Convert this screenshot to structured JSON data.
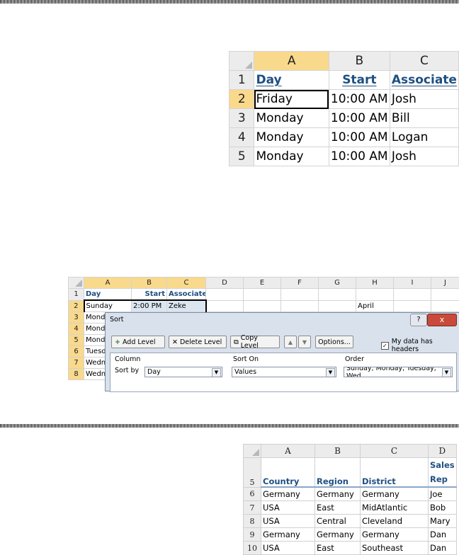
{
  "sheet1": {
    "col_headers": [
      "A",
      "B",
      "C"
    ],
    "header_row": {
      "num": "1",
      "cells": [
        "Day",
        "Start",
        "Associate"
      ]
    },
    "rows": [
      {
        "num": "2",
        "cells": [
          "Friday",
          "10:00 AM",
          "Josh"
        ]
      },
      {
        "num": "3",
        "cells": [
          "Monday",
          "10:00 AM",
          "Bill"
        ]
      },
      {
        "num": "4",
        "cells": [
          "Monday",
          "10:00 AM",
          "Logan"
        ]
      },
      {
        "num": "5",
        "cells": [
          "Monday",
          "10:00 AM",
          "Josh"
        ]
      }
    ]
  },
  "sheet2": {
    "col_headers": [
      "A",
      "B",
      "C",
      "D",
      "E",
      "F",
      "G",
      "H",
      "I",
      "J"
    ],
    "header_row": {
      "num": "1",
      "cells": [
        "Day",
        "Start",
        "Associate"
      ]
    },
    "row2": {
      "num": "2",
      "cells": [
        "Sunday",
        "2:00 PM",
        "Zeke"
      ],
      "h": "April"
    },
    "partial_rows": [
      {
        "num": "3",
        "a": "Mond"
      },
      {
        "num": "4",
        "a": "Mond"
      },
      {
        "num": "5",
        "a": "Mond"
      },
      {
        "num": "6",
        "a": "Tuesd"
      },
      {
        "num": "7",
        "a": "Wedn"
      },
      {
        "num": "8",
        "a": "Wedn"
      }
    ]
  },
  "sort_dialog": {
    "title": "Sort",
    "help": "?",
    "close": "x",
    "add_level": "Add Level",
    "delete_level": "Delete Level",
    "copy_level": "Copy Level",
    "options": "Options...",
    "headers_checkbox": "My data has headers",
    "col_column": "Column",
    "col_sort_on": "Sort On",
    "col_order": "Order",
    "sort_by_label": "Sort by",
    "sort_by_value": "Day",
    "sort_on_value": "Values",
    "order_value": "Sunday, Monday, Tuesday, Wed"
  },
  "sheet3": {
    "col_headers": [
      "A",
      "B",
      "C",
      "D"
    ],
    "header_row": {
      "num": "5",
      "cells": [
        "Country",
        "Region",
        "District",
        "Sales Rep"
      ]
    },
    "rows": [
      {
        "num": "6",
        "cells": [
          "Germany",
          "Germany",
          "Germany",
          "Joe"
        ]
      },
      {
        "num": "7",
        "cells": [
          "USA",
          "East",
          "MidAtlantic",
          "Bob"
        ]
      },
      {
        "num": "8",
        "cells": [
          "USA",
          "Central",
          "Cleveland",
          "Mary"
        ]
      },
      {
        "num": "9",
        "cells": [
          "Germany",
          "Germany",
          "Germany",
          "Dan"
        ]
      },
      {
        "num": "10",
        "cells": [
          "USA",
          "East",
          "Southeast",
          "Dan"
        ]
      }
    ]
  }
}
